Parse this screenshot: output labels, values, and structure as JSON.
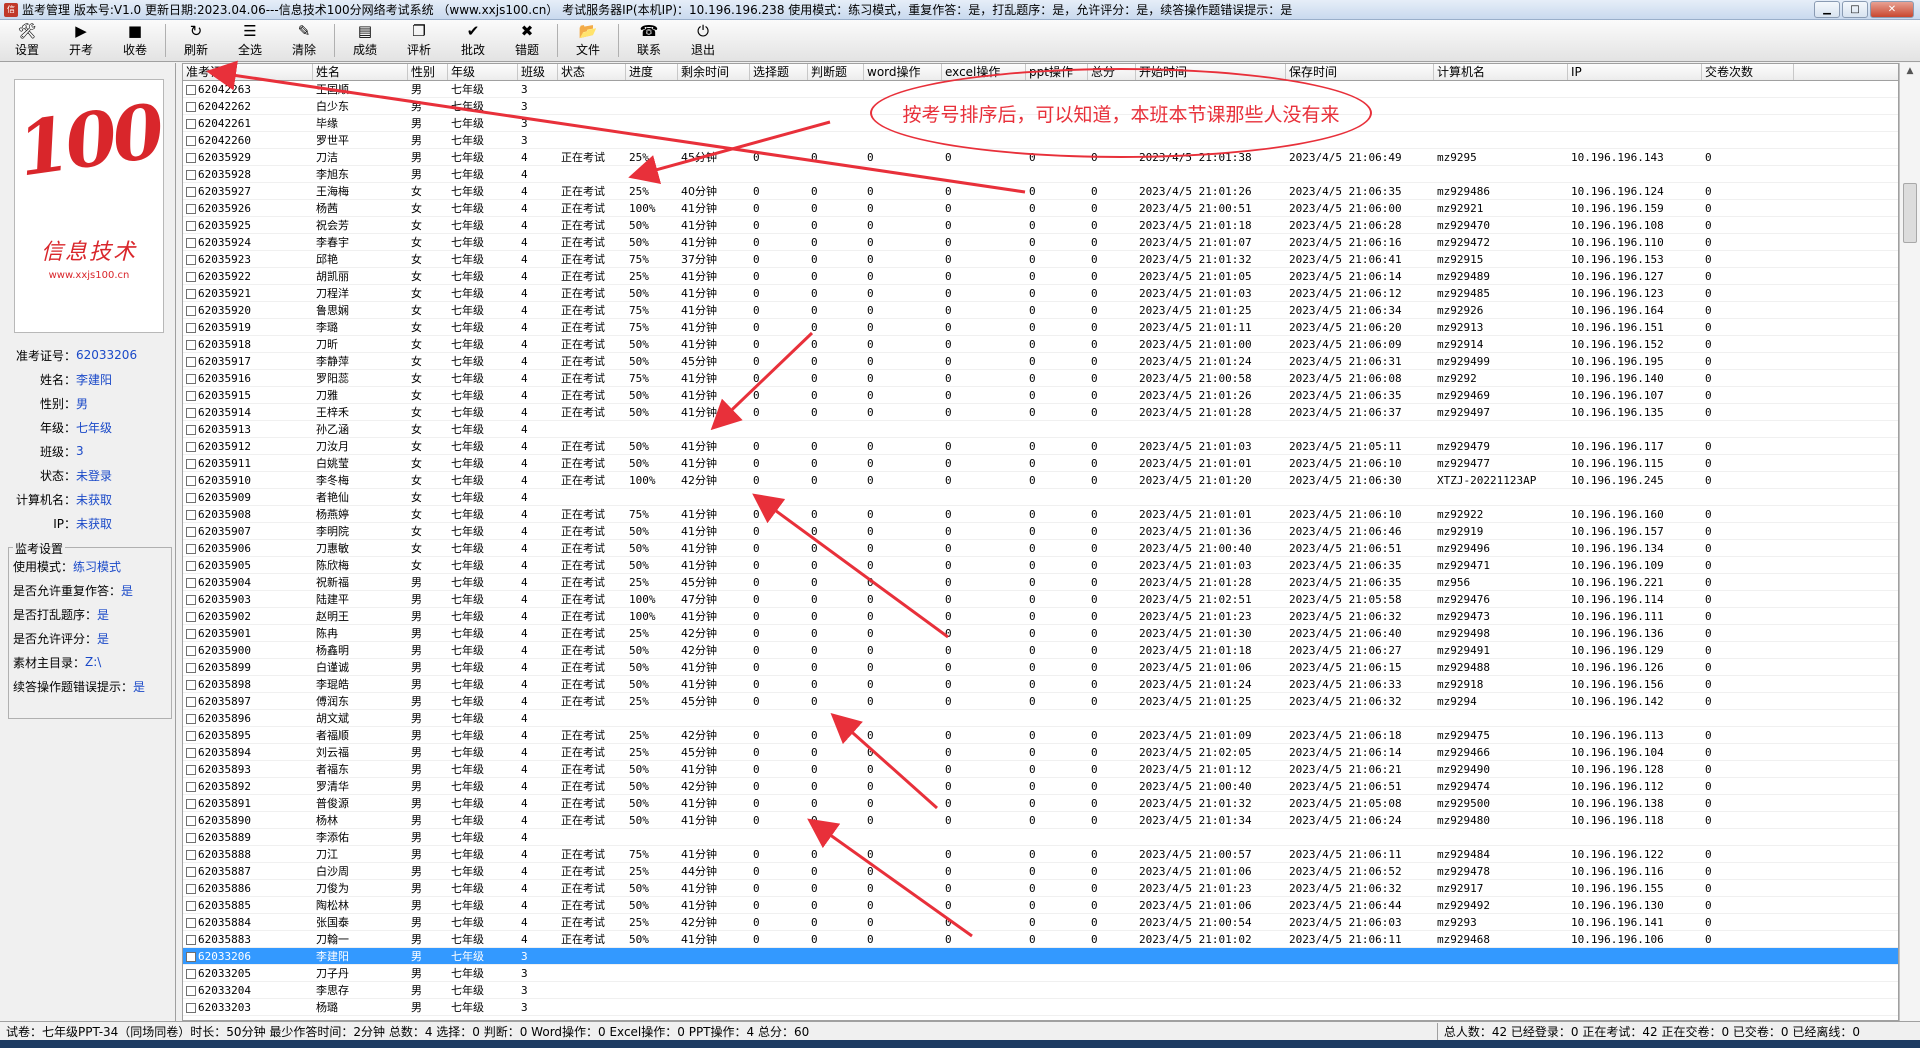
{
  "window": {
    "title": "监考管理 版本号:V1.0 更新日期:2023.04.06---信息技术100分网络考试系统  （www.xxjs100.cn）  考试服务器IP(本机IP)：10.196.196.238   使用模式：练习模式，重复作答：是，打乱题序：是，允许评分：是，续答操作题错误提示：是"
  },
  "toolbar": [
    {
      "label": "设置",
      "icon": "wrench-icon",
      "glyph": "🛠"
    },
    {
      "label": "开考",
      "icon": "play-icon",
      "glyph": "▶"
    },
    {
      "label": "收卷",
      "icon": "stop-icon",
      "glyph": "■"
    },
    {
      "label": "刷新",
      "icon": "refresh-icon",
      "glyph": "↻"
    },
    {
      "label": "全选",
      "icon": "select-all-icon",
      "glyph": "☰"
    },
    {
      "label": "清除",
      "icon": "eraser-icon",
      "glyph": "✎"
    },
    {
      "label": "成绩",
      "icon": "score-icon",
      "glyph": "▤"
    },
    {
      "label": "评析",
      "icon": "review-icon",
      "glyph": "❐"
    },
    {
      "label": "批改",
      "icon": "check-icon",
      "glyph": "✔"
    },
    {
      "label": "错题",
      "icon": "wrong-icon",
      "glyph": "✖"
    },
    {
      "label": "文件",
      "icon": "folder-icon",
      "glyph": "📂"
    },
    {
      "label": "联系",
      "icon": "phone-icon",
      "glyph": "☎"
    },
    {
      "label": "退出",
      "icon": "exit-icon",
      "glyph": "⏻"
    }
  ],
  "logo": {
    "big": "100",
    "cn": "信息技术",
    "url": "www.xxjs100.cn"
  },
  "student": {
    "labels": {
      "id": "准考证号：",
      "name": "姓名：",
      "gender": "性别：",
      "grade": "年级：",
      "class": "班级：",
      "status": "状态：",
      "computer": "计算机名：",
      "ip": "IP："
    },
    "id": "62033206",
    "name": "李建阳",
    "gender": "男",
    "grade": "七年级",
    "class": "3",
    "status": "未登录",
    "computer": "未获取",
    "ip": "未获取"
  },
  "settings": {
    "title": "监考设置",
    "rows": [
      {
        "label": "使用模式：",
        "value": "练习模式"
      },
      {
        "label": "是否允许重复作答：",
        "value": "是"
      },
      {
        "label": "是否打乱题序：",
        "value": "是"
      },
      {
        "label": "是否允许评分：",
        "value": "是"
      },
      {
        "label": "素材主目录：",
        "value": "Z:\\"
      },
      {
        "label": "续答操作题错误提示：",
        "value": "是"
      }
    ]
  },
  "columns": [
    "准考证号",
    "姓名",
    "性别",
    "年级",
    "班级",
    "状态",
    "进度",
    "剩余时间",
    "选择题",
    "判断题",
    "word操作",
    "excel操作",
    "ppt操作",
    "总分",
    "开始时间",
    "保存时间",
    "计算机名",
    "IP",
    "交卷次数"
  ],
  "rows": [
    [
      "62042263",
      "王国顺",
      "男",
      "七年级",
      "3",
      "",
      "",
      "",
      "",
      "",
      "",
      "",
      "",
      "",
      "",
      "",
      "",
      "",
      ""
    ],
    [
      "62042262",
      "白少东",
      "男",
      "七年级",
      "3",
      "",
      "",
      "",
      "",
      "",
      "",
      "",
      "",
      "",
      "",
      "",
      "",
      "",
      ""
    ],
    [
      "62042261",
      "毕缘",
      "男",
      "七年级",
      "3",
      "",
      "",
      "",
      "",
      "",
      "",
      "",
      "",
      "",
      "",
      "",
      "",
      "",
      ""
    ],
    [
      "62042260",
      "罗世平",
      "男",
      "七年级",
      "3",
      "",
      "",
      "",
      "",
      "",
      "",
      "",
      "",
      "",
      "",
      "",
      "",
      "",
      ""
    ],
    [
      "62035929",
      "刀洁",
      "男",
      "七年级",
      "4",
      "正在考试",
      "25%",
      "45分钟",
      "0",
      "0",
      "0",
      "0",
      "0",
      "0",
      "2023/4/5 21:01:38",
      "2023/4/5 21:06:49",
      "mz9295",
      "10.196.196.143",
      "0"
    ],
    [
      "62035928",
      "李旭东",
      "男",
      "七年级",
      "4",
      "",
      "",
      "",
      "",
      "",
      "",
      "",
      "",
      "",
      "",
      "",
      "",
      "",
      ""
    ],
    [
      "62035927",
      "王海梅",
      "女",
      "七年级",
      "4",
      "正在考试",
      "25%",
      "40分钟",
      "0",
      "0",
      "0",
      "0",
      "0",
      "0",
      "2023/4/5 21:01:26",
      "2023/4/5 21:06:35",
      "mz929486",
      "10.196.196.124",
      "0"
    ],
    [
      "62035926",
      "杨茜",
      "女",
      "七年级",
      "4",
      "正在考试",
      "100%",
      "41分钟",
      "0",
      "0",
      "0",
      "0",
      "0",
      "0",
      "2023/4/5 21:00:51",
      "2023/4/5 21:06:00",
      "mz92921",
      "10.196.196.159",
      "0"
    ],
    [
      "62035925",
      "祝会芳",
      "女",
      "七年级",
      "4",
      "正在考试",
      "50%",
      "41分钟",
      "0",
      "0",
      "0",
      "0",
      "0",
      "0",
      "2023/4/5 21:01:18",
      "2023/4/5 21:06:28",
      "mz929470",
      "10.196.196.108",
      "0"
    ],
    [
      "62035924",
      "李春宇",
      "女",
      "七年级",
      "4",
      "正在考试",
      "50%",
      "41分钟",
      "0",
      "0",
      "0",
      "0",
      "0",
      "0",
      "2023/4/5 21:01:07",
      "2023/4/5 21:06:16",
      "mz929472",
      "10.196.196.110",
      "0"
    ],
    [
      "62035923",
      "邱艳",
      "女",
      "七年级",
      "4",
      "正在考试",
      "75%",
      "37分钟",
      "0",
      "0",
      "0",
      "0",
      "0",
      "0",
      "2023/4/5 21:01:32",
      "2023/4/5 21:06:41",
      "mz92915",
      "10.196.196.153",
      "0"
    ],
    [
      "62035922",
      "胡凯丽",
      "女",
      "七年级",
      "4",
      "正在考试",
      "25%",
      "41分钟",
      "0",
      "0",
      "0",
      "0",
      "0",
      "0",
      "2023/4/5 21:01:05",
      "2023/4/5 21:06:14",
      "mz929489",
      "10.196.196.127",
      "0"
    ],
    [
      "62035921",
      "刀程洋",
      "女",
      "七年级",
      "4",
      "正在考试",
      "50%",
      "41分钟",
      "0",
      "0",
      "0",
      "0",
      "0",
      "0",
      "2023/4/5 21:01:03",
      "2023/4/5 21:06:12",
      "mz929485",
      "10.196.196.123",
      "0"
    ],
    [
      "62035920",
      "鲁思娴",
      "女",
      "七年级",
      "4",
      "正在考试",
      "75%",
      "41分钟",
      "0",
      "0",
      "0",
      "0",
      "0",
      "0",
      "2023/4/5 21:01:25",
      "2023/4/5 21:06:34",
      "mz92926",
      "10.196.196.164",
      "0"
    ],
    [
      "62035919",
      "李璐",
      "女",
      "七年级",
      "4",
      "正在考试",
      "75%",
      "41分钟",
      "0",
      "0",
      "0",
      "0",
      "0",
      "0",
      "2023/4/5 21:01:11",
      "2023/4/5 21:06:20",
      "mz92913",
      "10.196.196.151",
      "0"
    ],
    [
      "62035918",
      "刀昕",
      "女",
      "七年级",
      "4",
      "正在考试",
      "50%",
      "41分钟",
      "0",
      "0",
      "0",
      "0",
      "0",
      "0",
      "2023/4/5 21:01:00",
      "2023/4/5 21:06:09",
      "mz92914",
      "10.196.196.152",
      "0"
    ],
    [
      "62035917",
      "李静萍",
      "女",
      "七年级",
      "4",
      "正在考试",
      "50%",
      "45分钟",
      "0",
      "0",
      "0",
      "0",
      "0",
      "0",
      "2023/4/5 21:01:24",
      "2023/4/5 21:06:31",
      "mz929499",
      "10.196.196.195",
      "0"
    ],
    [
      "62035916",
      "罗阳蕊",
      "女",
      "七年级",
      "4",
      "正在考试",
      "75%",
      "41分钟",
      "0",
      "0",
      "0",
      "0",
      "0",
      "0",
      "2023/4/5 21:00:58",
      "2023/4/5 21:06:08",
      "mz9292",
      "10.196.196.140",
      "0"
    ],
    [
      "62035915",
      "刀雅",
      "女",
      "七年级",
      "4",
      "正在考试",
      "50%",
      "41分钟",
      "0",
      "0",
      "0",
      "0",
      "0",
      "0",
      "2023/4/5 21:01:26",
      "2023/4/5 21:06:35",
      "mz929469",
      "10.196.196.107",
      "0"
    ],
    [
      "62035914",
      "王梓禾",
      "女",
      "七年级",
      "4",
      "正在考试",
      "50%",
      "41分钟",
      "0",
      "0",
      "0",
      "0",
      "0",
      "0",
      "2023/4/5 21:01:28",
      "2023/4/5 21:06:37",
      "mz929497",
      "10.196.196.135",
      "0"
    ],
    [
      "62035913",
      "孙乙涵",
      "女",
      "七年级",
      "4",
      "",
      "",
      "",
      "",
      "",
      "",
      "",
      "",
      "",
      "",
      "",
      "",
      "",
      ""
    ],
    [
      "62035912",
      "刀汝月",
      "女",
      "七年级",
      "4",
      "正在考试",
      "50%",
      "41分钟",
      "0",
      "0",
      "0",
      "0",
      "0",
      "0",
      "2023/4/5 21:01:03",
      "2023/4/5 21:05:11",
      "mz929479",
      "10.196.196.117",
      "0"
    ],
    [
      "62035911",
      "白姚莹",
      "女",
      "七年级",
      "4",
      "正在考试",
      "50%",
      "41分钟",
      "0",
      "0",
      "0",
      "0",
      "0",
      "0",
      "2023/4/5 21:01:01",
      "2023/4/5 21:06:10",
      "mz929477",
      "10.196.196.115",
      "0"
    ],
    [
      "62035910",
      "李冬梅",
      "女",
      "七年级",
      "4",
      "正在考试",
      "100%",
      "42分钟",
      "0",
      "0",
      "0",
      "0",
      "0",
      "0",
      "2023/4/5 21:01:20",
      "2023/4/5 21:06:30",
      "XTZJ-20221123AP",
      "10.196.196.245",
      "0"
    ],
    [
      "62035909",
      "者艳仙",
      "女",
      "七年级",
      "4",
      "",
      "",
      "",
      "",
      "",
      "",
      "",
      "",
      "",
      "",
      "",
      "",
      "",
      ""
    ],
    [
      "62035908",
      "杨燕婷",
      "女",
      "七年级",
      "4",
      "正在考试",
      "75%",
      "41分钟",
      "0",
      "0",
      "0",
      "0",
      "0",
      "0",
      "2023/4/5 21:01:01",
      "2023/4/5 21:06:10",
      "mz92922",
      "10.196.196.160",
      "0"
    ],
    [
      "62035907",
      "李明院",
      "女",
      "七年级",
      "4",
      "正在考试",
      "50%",
      "41分钟",
      "0",
      "0",
      "0",
      "0",
      "0",
      "0",
      "2023/4/5 21:01:36",
      "2023/4/5 21:06:46",
      "mz92919",
      "10.196.196.157",
      "0"
    ],
    [
      "62035906",
      "刀惠敏",
      "女",
      "七年级",
      "4",
      "正在考试",
      "50%",
      "41分钟",
      "0",
      "0",
      "0",
      "0",
      "0",
      "0",
      "2023/4/5 21:00:40",
      "2023/4/5 21:06:51",
      "mz929496",
      "10.196.196.134",
      "0"
    ],
    [
      "62035905",
      "陈欣梅",
      "女",
      "七年级",
      "4",
      "正在考试",
      "50%",
      "41分钟",
      "0",
      "0",
      "0",
      "0",
      "0",
      "0",
      "2023/4/5 21:01:03",
      "2023/4/5 21:06:35",
      "mz929471",
      "10.196.196.109",
      "0"
    ],
    [
      "62035904",
      "祝新福",
      "男",
      "七年级",
      "4",
      "正在考试",
      "25%",
      "45分钟",
      "0",
      "0",
      "0",
      "0",
      "0",
      "0",
      "2023/4/5 21:01:28",
      "2023/4/5 21:06:35",
      "mz956",
      "10.196.196.221",
      "0"
    ],
    [
      "62035903",
      "陆建平",
      "男",
      "七年级",
      "4",
      "正在考试",
      "100%",
      "47分钟",
      "0",
      "0",
      "0",
      "0",
      "0",
      "0",
      "2023/4/5 21:02:51",
      "2023/4/5 21:05:58",
      "mz929476",
      "10.196.196.114",
      "0"
    ],
    [
      "62035902",
      "赵明王",
      "男",
      "七年级",
      "4",
      "正在考试",
      "100%",
      "41分钟",
      "0",
      "0",
      "0",
      "0",
      "0",
      "0",
      "2023/4/5 21:01:23",
      "2023/4/5 21:06:32",
      "mz929473",
      "10.196.196.111",
      "0"
    ],
    [
      "62035901",
      "陈冉",
      "男",
      "七年级",
      "4",
      "正在考试",
      "25%",
      "42分钟",
      "0",
      "0",
      "0",
      "0",
      "0",
      "0",
      "2023/4/5 21:01:30",
      "2023/4/5 21:06:40",
      "mz929498",
      "10.196.196.136",
      "0"
    ],
    [
      "62035900",
      "杨鑫明",
      "男",
      "七年级",
      "4",
      "正在考试",
      "50%",
      "42分钟",
      "0",
      "0",
      "0",
      "0",
      "0",
      "0",
      "2023/4/5 21:01:18",
      "2023/4/5 21:06:27",
      "mz929491",
      "10.196.196.129",
      "0"
    ],
    [
      "62035899",
      "白谨诚",
      "男",
      "七年级",
      "4",
      "正在考试",
      "50%",
      "41分钟",
      "0",
      "0",
      "0",
      "0",
      "0",
      "0",
      "2023/4/5 21:01:06",
      "2023/4/5 21:06:15",
      "mz929488",
      "10.196.196.126",
      "0"
    ],
    [
      "62035898",
      "李琨皓",
      "男",
      "七年级",
      "4",
      "正在考试",
      "50%",
      "41分钟",
      "0",
      "0",
      "0",
      "0",
      "0",
      "0",
      "2023/4/5 21:01:24",
      "2023/4/5 21:06:33",
      "mz92918",
      "10.196.196.156",
      "0"
    ],
    [
      "62035897",
      "傅润东",
      "男",
      "七年级",
      "4",
      "正在考试",
      "25%",
      "45分钟",
      "0",
      "0",
      "0",
      "0",
      "0",
      "0",
      "2023/4/5 21:01:25",
      "2023/4/5 21:06:32",
      "mz9294",
      "10.196.196.142",
      "0"
    ],
    [
      "62035896",
      "胡文斌",
      "男",
      "七年级",
      "4",
      "",
      "",
      "",
      "",
      "",
      "",
      "",
      "",
      "",
      "",
      "",
      "",
      "",
      ""
    ],
    [
      "62035895",
      "者福顺",
      "男",
      "七年级",
      "4",
      "正在考试",
      "25%",
      "42分钟",
      "0",
      "0",
      "0",
      "0",
      "0",
      "0",
      "2023/4/5 21:01:09",
      "2023/4/5 21:06:18",
      "mz929475",
      "10.196.196.113",
      "0"
    ],
    [
      "62035894",
      "刘云福",
      "男",
      "七年级",
      "4",
      "正在考试",
      "25%",
      "45分钟",
      "0",
      "0",
      "0",
      "0",
      "0",
      "0",
      "2023/4/5 21:02:05",
      "2023/4/5 21:06:14",
      "mz929466",
      "10.196.196.104",
      "0"
    ],
    [
      "62035893",
      "者福东",
      "男",
      "七年级",
      "4",
      "正在考试",
      "50%",
      "41分钟",
      "0",
      "0",
      "0",
      "0",
      "0",
      "0",
      "2023/4/5 21:01:12",
      "2023/4/5 21:06:21",
      "mz929490",
      "10.196.196.128",
      "0"
    ],
    [
      "62035892",
      "罗清华",
      "男",
      "七年级",
      "4",
      "正在考试",
      "50%",
      "42分钟",
      "0",
      "0",
      "0",
      "0",
      "0",
      "0",
      "2023/4/5 21:00:40",
      "2023/4/5 21:06:51",
      "mz929474",
      "10.196.196.112",
      "0"
    ],
    [
      "62035891",
      "普俊源",
      "男",
      "七年级",
      "4",
      "正在考试",
      "50%",
      "41分钟",
      "0",
      "0",
      "0",
      "0",
      "0",
      "0",
      "2023/4/5 21:01:32",
      "2023/4/5 21:05:08",
      "mz929500",
      "10.196.196.138",
      "0"
    ],
    [
      "62035890",
      "杨林",
      "男",
      "七年级",
      "4",
      "正在考试",
      "50%",
      "41分钟",
      "0",
      "0",
      "0",
      "0",
      "0",
      "0",
      "2023/4/5 21:01:34",
      "2023/4/5 21:06:24",
      "mz929480",
      "10.196.196.118",
      "0"
    ],
    [
      "62035889",
      "李添佑",
      "男",
      "七年级",
      "4",
      "",
      "",
      "",
      "",
      "",
      "",
      "",
      "",
      "",
      "",
      "",
      "",
      "",
      ""
    ],
    [
      "62035888",
      "刀江",
      "男",
      "七年级",
      "4",
      "正在考试",
      "75%",
      "41分钟",
      "0",
      "0",
      "0",
      "0",
      "0",
      "0",
      "2023/4/5 21:00:57",
      "2023/4/5 21:06:11",
      "mz929484",
      "10.196.196.122",
      "0"
    ],
    [
      "62035887",
      "白沙周",
      "男",
      "七年级",
      "4",
      "正在考试",
      "25%",
      "44分钟",
      "0",
      "0",
      "0",
      "0",
      "0",
      "0",
      "2023/4/5 21:01:06",
      "2023/4/5 21:06:52",
      "mz929478",
      "10.196.196.116",
      "0"
    ],
    [
      "62035886",
      "刀俊为",
      "男",
      "七年级",
      "4",
      "正在考试",
      "50%",
      "41分钟",
      "0",
      "0",
      "0",
      "0",
      "0",
      "0",
      "2023/4/5 21:01:23",
      "2023/4/5 21:06:32",
      "mz92917",
      "10.196.196.155",
      "0"
    ],
    [
      "62035885",
      "陶松林",
      "男",
      "七年级",
      "4",
      "正在考试",
      "50%",
      "41分钟",
      "0",
      "0",
      "0",
      "0",
      "0",
      "0",
      "2023/4/5 21:01:06",
      "2023/4/5 21:06:44",
      "mz929492",
      "10.196.196.130",
      "0"
    ],
    [
      "62035884",
      "张国泰",
      "男",
      "七年级",
      "4",
      "正在考试",
      "25%",
      "42分钟",
      "0",
      "0",
      "0",
      "0",
      "0",
      "0",
      "2023/4/5 21:00:54",
      "2023/4/5 21:06:03",
      "mz9293",
      "10.196.196.141",
      "0"
    ],
    [
      "62035883",
      "刀翰一",
      "男",
      "七年级",
      "4",
      "正在考试",
      "50%",
      "41分钟",
      "0",
      "0",
      "0",
      "0",
      "0",
      "0",
      "2023/4/5 21:01:02",
      "2023/4/5 21:06:11",
      "mz929468",
      "10.196.196.106",
      "0"
    ],
    [
      "62033206",
      "李建阳",
      "男",
      "七年级",
      "3",
      "",
      "",
      "",
      "",
      "",
      "",
      "",
      "",
      "",
      "",
      "",
      "",
      "",
      ""
    ],
    [
      "62033205",
      "刀子丹",
      "男",
      "七年级",
      "3",
      "",
      "",
      "",
      "",
      "",
      "",
      "",
      "",
      "",
      "",
      "",
      "",
      "",
      ""
    ],
    [
      "62033204",
      "李思存",
      "男",
      "七年级",
      "3",
      "",
      "",
      "",
      "",
      "",
      "",
      "",
      "",
      "",
      "",
      "",
      "",
      "",
      ""
    ],
    [
      "62033203",
      "杨璐",
      "男",
      "七年级",
      "3",
      "",
      "",
      "",
      "",
      "",
      "",
      "",
      "",
      "",
      "",
      "",
      "",
      "",
      ""
    ]
  ],
  "selected_id": "62033206",
  "annotation": "按考号排序后，可以知道，本班本节课那些人没有来",
  "status": {
    "left": "试卷：七年级PPT-34（同场同卷）时长：50分钟 最少作答时间：2分钟  总数：4 选择：0 判断：0 Word操作：0 Excel操作：0 PPT操作：4 总分：60",
    "right": "总人数：42 已经登录：0 正在考试：42 正在交卷：0 已交卷：0 已经离线：0"
  },
  "colors": {
    "annotation": "#e8303a",
    "selection": "#3399ff",
    "link": "#1a49c8"
  }
}
